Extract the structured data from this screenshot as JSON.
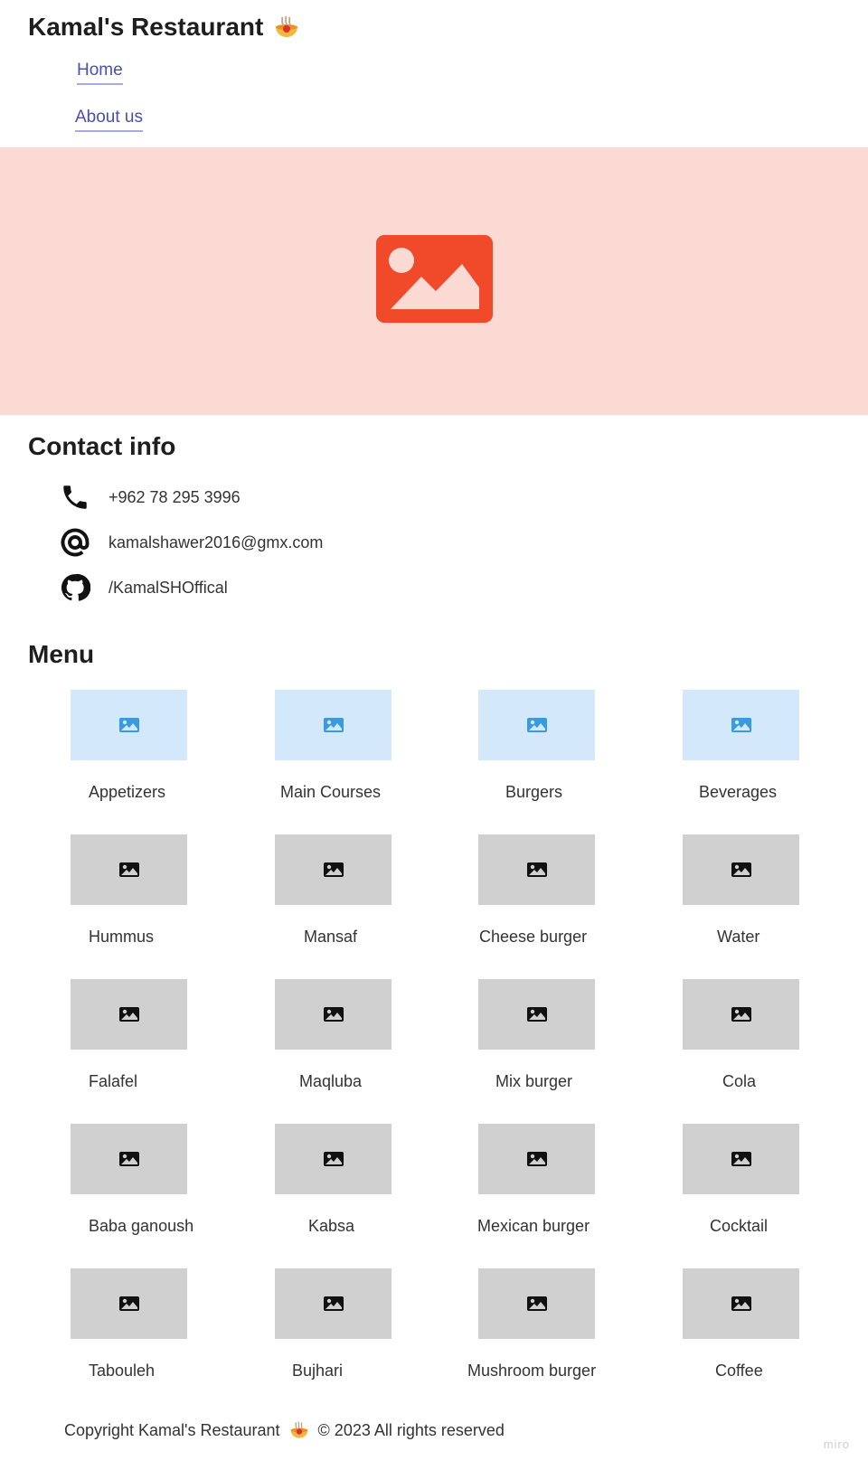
{
  "header": {
    "title": "Kamal's Restaurant",
    "title_icon": "noodle-bowl-icon",
    "nav": [
      {
        "label": "Home"
      },
      {
        "label": "About us"
      }
    ]
  },
  "hero": {
    "icon": "image-placeholder-icon",
    "background": "#fbdad3",
    "icon_color": "#f04a2a"
  },
  "contact": {
    "title": "Contact info",
    "items": [
      {
        "icon": "phone-icon",
        "text": "+962 78 295 3996"
      },
      {
        "icon": "at-sign-icon",
        "text": "kamalshawer2016@gmx.com"
      },
      {
        "icon": "github-icon",
        "text": "/KamalSHOffical"
      }
    ]
  },
  "menu": {
    "title": "Menu",
    "categories": [
      "Appetizers",
      "Main Courses",
      "Burgers",
      "Beverages"
    ],
    "rows": [
      [
        "Hummus",
        "Mansaf",
        "Cheese burger",
        "Water"
      ],
      [
        "Falafel",
        "Maqluba",
        "Mix burger",
        "Cola"
      ],
      [
        "Baba ganoush",
        "Kabsa",
        "Mexican burger",
        "Cocktail"
      ],
      [
        "Tabouleh",
        "Bujhari",
        "Mushroom burger",
        "Coffee"
      ]
    ]
  },
  "footer": {
    "text_before": "Copyright Kamal's Restaurant",
    "text_after": "© 2023 All rights reserved",
    "watermark": "miro"
  },
  "colors": {
    "category_thumb": "#d3e8fb",
    "category_icon": "#3a9ae0",
    "item_thumb": "#d0d0d0",
    "link": "#4a4fb0"
  }
}
